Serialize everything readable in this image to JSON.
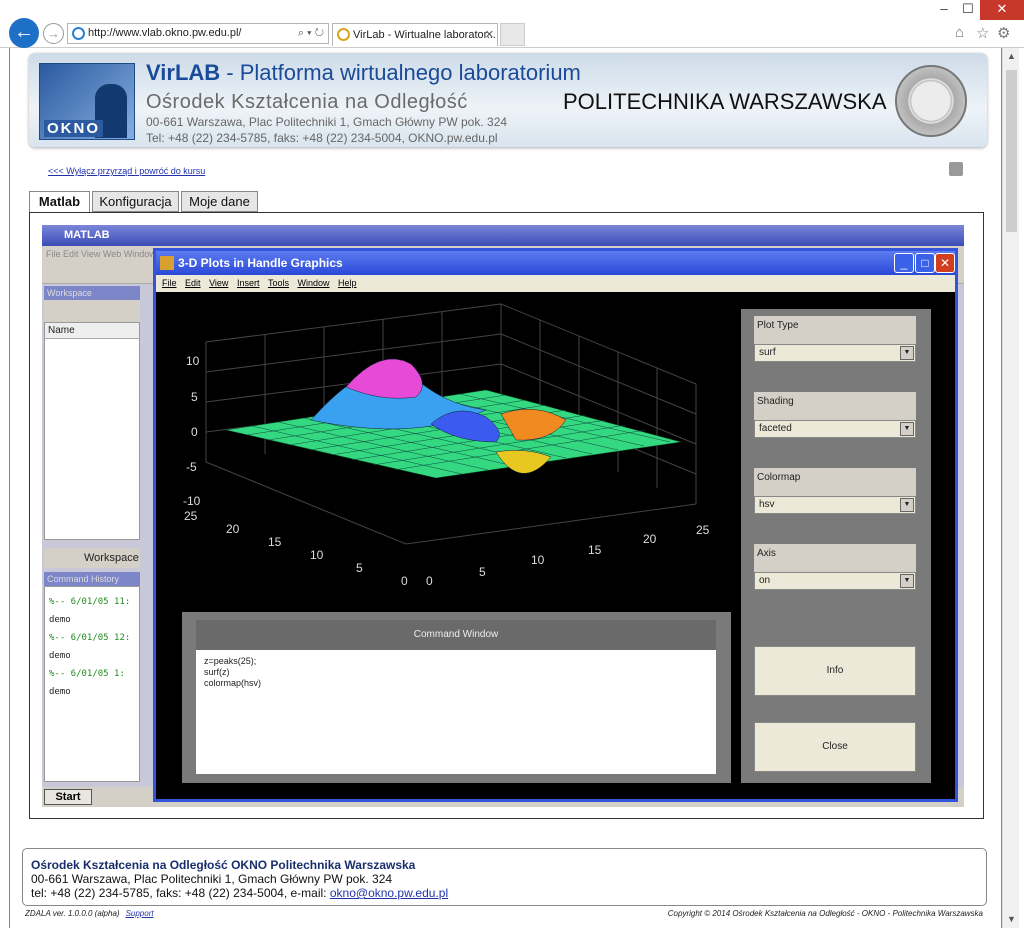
{
  "browser": {
    "window_controls": [
      "–",
      "☐",
      "✕"
    ],
    "address": "http://www.vlab.okno.pw.edu.pl/",
    "address_icons": "⌕ ▾ ↻",
    "tab_title": "VirLab - Wirtualne laborator...",
    "tab_close": "✕",
    "right_icons": [
      "⌂",
      "☆",
      "⚙"
    ]
  },
  "banner": {
    "logo_text": "OKNO",
    "title_bold": "VirLAB",
    "title_rest": " - Platforma wirtualnego laboratorium",
    "subtitle": "Ośrodek Kształcenia na Odległość",
    "address": "00-661 Warszawa, Plac Politechniki 1, Gmach Główny PW pok. 324",
    "contact": "Tel: +48 (22) 234-5785,  faks: +48 (22) 234-5004,   OKNO.pw.edu.pl",
    "university": "POLITECHNIKA WARSZAWSKA"
  },
  "back_link": "<<< Wyłącz przyrząd i powróć do kursu",
  "tabs": [
    "Matlab",
    "Konfiguracja",
    "Moje dane"
  ],
  "matlab": {
    "title": "MATLAB",
    "menu": "File  Edit  View  Web  Window  Help",
    "workspace_title": "Workspace",
    "workspace_header": "Name",
    "workspace_tab": "Workspace",
    "command_history_title": "Command History",
    "history": [
      {
        "stamp": "%-- 6/01/05 11:",
        "cmd": "demo"
      },
      {
        "stamp": "%-- 6/01/05 12:",
        "cmd": "demo"
      },
      {
        "stamp": "%-- 6/01/05  1:",
        "cmd": "demo"
      }
    ],
    "start": "Start"
  },
  "plot_window": {
    "title": "3-D Plots in Handle Graphics",
    "menu": [
      "File",
      "Edit",
      "View",
      "Insert",
      "Tools",
      "Window",
      "Help"
    ],
    "buttons": [
      "_",
      "□",
      "✕"
    ],
    "controls": [
      {
        "label": "Plot Type",
        "value": "surf"
      },
      {
        "label": "Shading",
        "value": "faceted"
      },
      {
        "label": "Colormap",
        "value": "hsv"
      },
      {
        "label": "Axis",
        "value": "on"
      }
    ],
    "info_button": "Info",
    "close_button": "Close",
    "command_window_title": "Command Window",
    "command_lines": [
      "z=peaks(25);",
      "surf(z)",
      "colormap(hsv)"
    ],
    "axes": {
      "z_ticks": [
        "10",
        "5",
        "0",
        "-5",
        "-10"
      ],
      "left_ticks": [
        "25",
        "20",
        "15",
        "10",
        "5",
        "0"
      ],
      "right_ticks": [
        "0",
        "5",
        "10",
        "15",
        "20",
        "25"
      ]
    }
  },
  "footer": {
    "org": "Ośrodek Kształcenia na Odległość OKNO Politechnika Warszawska",
    "address": "00-661 Warszawa, Plac Politechniki 1, Gmach Główny PW pok. 324",
    "contact_prefix": "tel: +48 (22) 234-5785, faks: +48 (22) 234-5004, e-mail: ",
    "email": "okno@okno.pw.edu.pl",
    "version": "ZDALA ver. 1.0.0.0 (alpha)",
    "support": "Support",
    "copyright": "Copyright © 2014 Ośrodek Kształcenia na Odległość - OKNO - Politechnika Warszawska"
  }
}
